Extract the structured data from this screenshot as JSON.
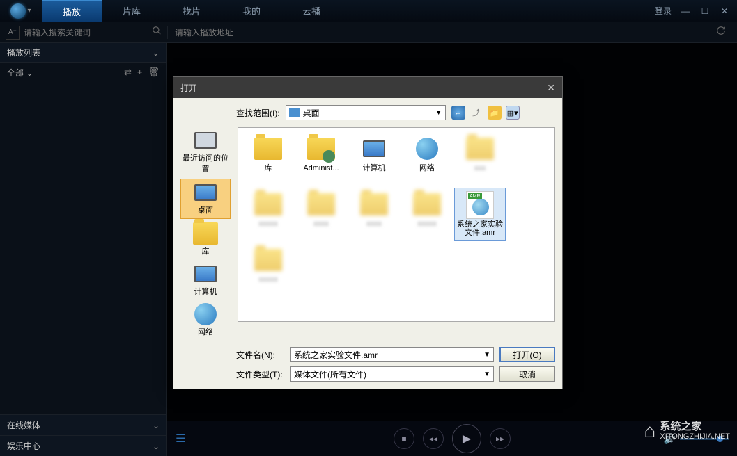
{
  "topbar": {
    "tabs": [
      "播放",
      "片库",
      "找片",
      "我的",
      "云播"
    ],
    "login": "登录"
  },
  "search": {
    "font_btn": "A⁺",
    "placeholder": "请输入搜索关键词"
  },
  "address": {
    "placeholder": "请输入播放地址"
  },
  "sidebar": {
    "playlist_title": "播放列表",
    "filter_label": "全部",
    "sections": {
      "online": "在线媒体",
      "entertainment": "娱乐中心"
    }
  },
  "dialog": {
    "title": "打开",
    "lookin_label": "查找范围(I):",
    "lookin_value": "桌面",
    "places": [
      {
        "label": "最近访问的位置",
        "icon": "recent"
      },
      {
        "label": "桌面",
        "icon": "desktop",
        "selected": true
      },
      {
        "label": "库",
        "icon": "library"
      },
      {
        "label": "计算机",
        "icon": "computer"
      },
      {
        "label": "网络",
        "icon": "network"
      }
    ],
    "files_row1": [
      {
        "label": "库",
        "icon": "folder"
      },
      {
        "label": "Administ...",
        "icon": "folder-user"
      },
      {
        "label": "计算机",
        "icon": "computer"
      },
      {
        "label": "网络",
        "icon": "network"
      },
      {
        "label": "",
        "icon": "folder",
        "blurred": true
      }
    ],
    "files_row2_selected": {
      "label": "系统之家实验文件.amr",
      "icon": "amr"
    },
    "filename_label": "文件名(N):",
    "filename_value": "系统之家实验文件.amr",
    "filetype_label": "文件类型(T):",
    "filetype_value": "媒体文件(所有文件)",
    "open_btn": "打开(O)",
    "cancel_btn": "取消"
  },
  "watermark": {
    "title": "系统之家",
    "url": "XITONGZHIJIA.NET"
  }
}
